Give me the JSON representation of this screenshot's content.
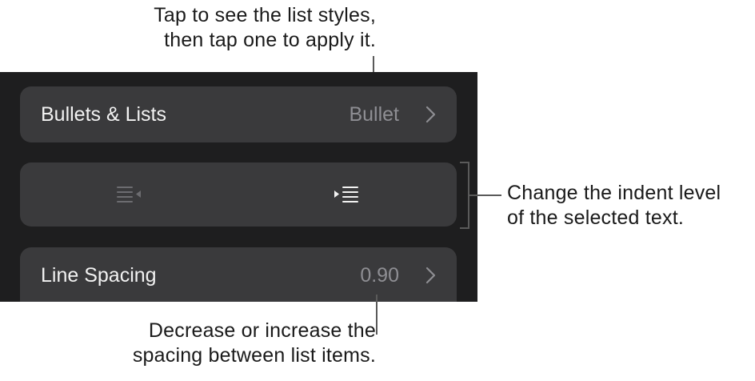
{
  "callouts": {
    "list_styles": {
      "line1": "Tap to see the list styles,",
      "line2": "then tap one to apply it."
    },
    "indent": {
      "line1": "Change the indent level",
      "line2": "of the selected text."
    },
    "spacing": {
      "line1": "Decrease or increase the",
      "line2": "spacing between list items."
    }
  },
  "panel": {
    "bullets_row": {
      "label": "Bullets & Lists",
      "value": "Bullet",
      "icon": "chevron-right-icon"
    },
    "indent_row": {
      "outdent_icon": "decrease-indent-icon",
      "indent_icon": "increase-indent-icon",
      "outdent_enabled": false,
      "indent_enabled": true
    },
    "spacing_row": {
      "label": "Line Spacing",
      "value": "0.90",
      "icon": "chevron-right-icon"
    }
  },
  "colors": {
    "panel_background": "#1e1e1f",
    "row_background": "#3a3a3c",
    "label_text": "#f2f2f2",
    "value_text": "#8e8e93",
    "disabled_icon": "#6c6c70",
    "callout_text": "#1a1a1a"
  }
}
